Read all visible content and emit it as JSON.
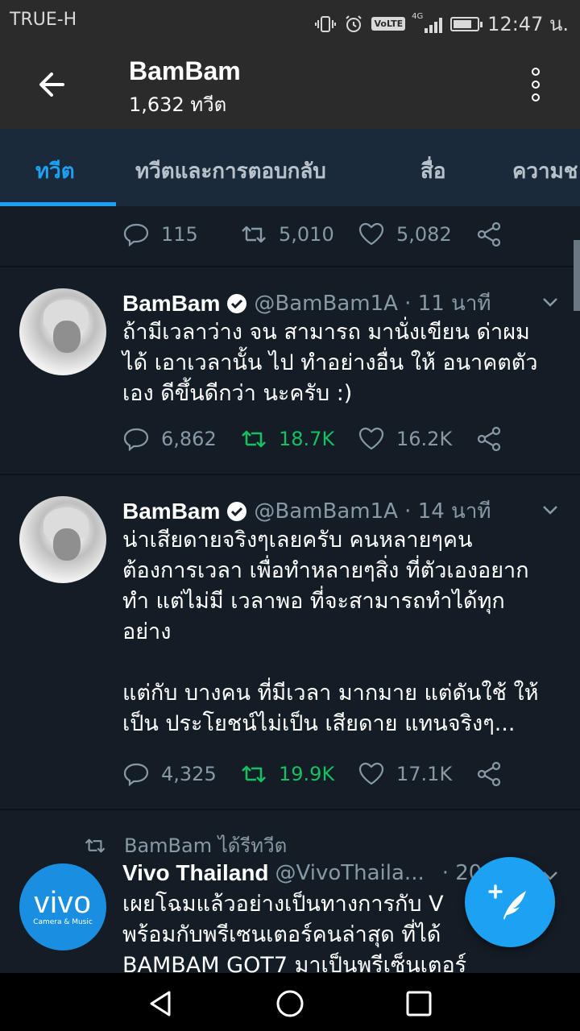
{
  "statusbar": {
    "carrier": "TRUE-H",
    "volte": "VoLTE",
    "network": "4G",
    "battery_level": 0.8,
    "time": "12:47 น."
  },
  "header": {
    "title": "BamBam",
    "subtitle": "1,632 ทวีต"
  },
  "tabs": [
    "ทวีต",
    "ทวีตและการตอบกลับ",
    "สื่อ",
    "ความช"
  ],
  "top_tweet_stats": {
    "replies": "115",
    "retweets": "5,010",
    "likes": "5,082"
  },
  "tweets": [
    {
      "name": "BamBam",
      "handle": "@BamBam1A · 11 นาที",
      "text": "ถ้ามีเวลาว่าง จน สามารถ มานั่งเขียน ด่าผม\nได้ เอาเวลานั้น ไป ทำอย่างอื่น ให้ อนาคตตัว\nเอง ดีขึ้นดีกว่า นะครับ :)",
      "replies": "6,862",
      "retweets": "18.7K",
      "likes": "16.2K"
    },
    {
      "name": "BamBam",
      "handle": "@BamBam1A · 14 นาที",
      "text": "น่าเสียดายจริงๆเลยครับ คนหลายๆคน\nต้องการเวลา เพื่อทำหลายๆสิ่ง ที่ตัวเองอยาก\nทำ แต่ไม่มี เวลาพอ ที่จะสามารถทำได้ทุก\nอย่าง\n\nแต่กับ บางคน ที่มีเวลา มากมาย แต่ดันใช้ ให้\nเป็น ประโยชน์ไม่เป็น เสียดาย แทนจริงๆ...",
      "replies": "4,325",
      "retweets": "19.9K",
      "likes": "17.1K"
    }
  ],
  "retweet": {
    "label": "BamBam ได้รีทวีต",
    "name": "Vivo Thailand",
    "handle": "@VivoThaila...",
    "time": "· 20",
    "text": "เผยโฉมแล้วอย่างเป็นทางการกับ V\nพร้อมกับพรีเซนเตอร์คนล่าสุด ที่ได้\nBAMBAM GOT7 มาเป็นพรีเซ็นเตอร์",
    "avatar_logo": "vivo",
    "avatar_tagline": "Camera & Music"
  },
  "colors": {
    "accent": "#1da1f2",
    "retweet_green": "#17bf63",
    "background": "#141d26"
  }
}
